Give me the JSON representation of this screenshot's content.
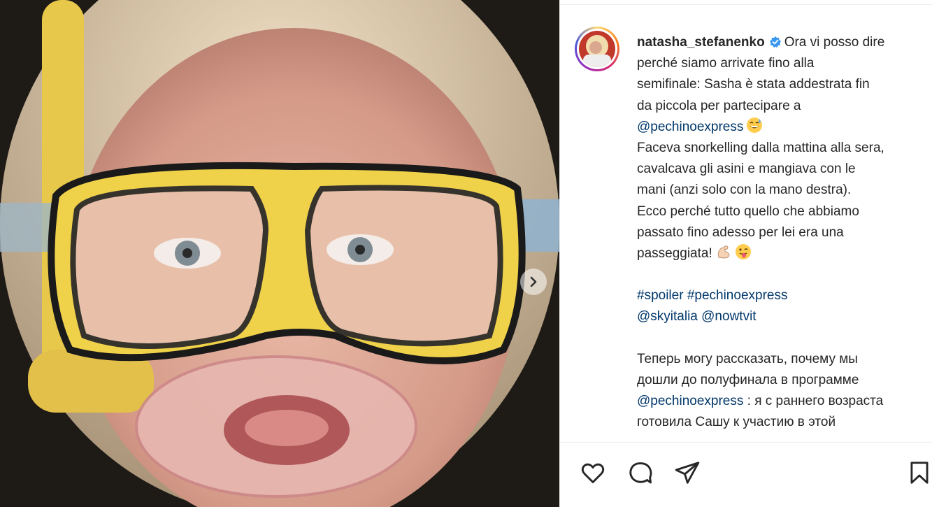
{
  "post": {
    "username": "natasha_stefanenko",
    "caption_lines": [
      {
        "type": "header",
        "text": "Ora vi posso dire"
      },
      {
        "type": "text",
        "text": "perché siamo arrivate fino alla"
      },
      {
        "type": "text",
        "text": "semifinale: Sasha è stata addestrata fin"
      },
      {
        "type": "text",
        "text": "da piccola per partecipare a"
      },
      {
        "type": "link",
        "text": "@pechinoexpress",
        "emoji": "grinning-sweat-emoji"
      },
      {
        "type": "text",
        "text": "Faceva snorkelling dalla mattina alla sera,"
      },
      {
        "type": "text",
        "text": "cavalcava gli asini e mangiava con le"
      },
      {
        "type": "text",
        "text": "mani (anzi solo con la mano destra)."
      },
      {
        "type": "text",
        "text": "Ecco perché tutto quello che abbiamo"
      },
      {
        "type": "text",
        "text": "passato fino adesso per lei era una"
      },
      {
        "type": "text",
        "text": "passeggiata!",
        "emojis": [
          "flexed-biceps-emoji",
          "winking-tongue-emoji"
        ]
      },
      {
        "type": "blank"
      },
      {
        "type": "link",
        "text": "#spoiler #pechinoexpress"
      },
      {
        "type": "link",
        "text": "@skyitalia @nowtvit"
      },
      {
        "type": "blank"
      },
      {
        "type": "text",
        "text": "Теперь могу рассказать, почему мы"
      },
      {
        "type": "text",
        "text": "дошли до полуфинала в программе"
      },
      {
        "type": "mixed",
        "link": "@pechinoexpress",
        "text": " : я с раннего возраста"
      },
      {
        "type": "text",
        "text": "готовила Сашу к участию в этой"
      }
    ]
  },
  "icons": {
    "verified": "verified-badge-icon",
    "next": "chevron-right-icon",
    "like": "heart-icon",
    "comment": "comment-icon",
    "share": "paper-plane-icon",
    "save": "bookmark-icon"
  },
  "colors": {
    "link": "#00376b",
    "verified": "#3897f0",
    "text": "#262626"
  }
}
